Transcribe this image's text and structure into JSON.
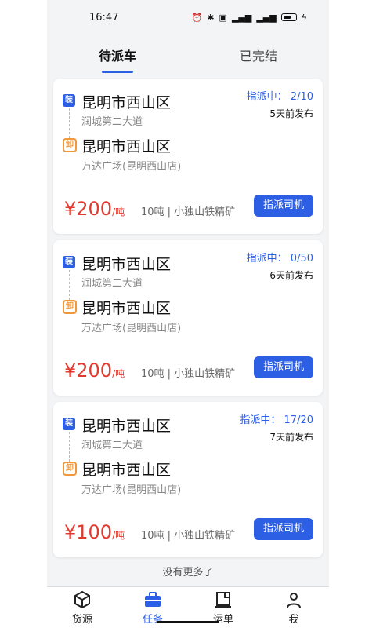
{
  "status_bar": {
    "time": "16:47",
    "icons": [
      "alarm-icon",
      "bluetooth-icon",
      "hd-icon",
      "signal-icon",
      "signal-icon",
      "battery-icon",
      "charging-icon"
    ]
  },
  "tabs": [
    {
      "label": "待派车",
      "active": true
    },
    {
      "label": "已完结",
      "active": false
    }
  ],
  "cards": [
    {
      "load_badge": "装",
      "unload_badge": "卸",
      "origin_city": "昆明市西山区",
      "origin_address": "润城第二大道",
      "dest_city": "昆明市西山区",
      "dest_address": "万达广场(昆明西山店)",
      "assign_status": "指派中：  2/10",
      "posted": "5天前发布",
      "price": "¥200",
      "price_unit": "/吨",
      "spec": "10吨 | 小独山铁精矿",
      "button": "指派司机"
    },
    {
      "load_badge": "装",
      "unload_badge": "卸",
      "origin_city": "昆明市西山区",
      "origin_address": "润城第二大道",
      "dest_city": "昆明市西山区",
      "dest_address": "万达广场(昆明西山店)",
      "assign_status": "指派中：  0/50",
      "posted": "6天前发布",
      "price": "¥200",
      "price_unit": "/吨",
      "spec": "10吨 | 小独山铁精矿",
      "button": "指派司机"
    },
    {
      "load_badge": "装",
      "unload_badge": "卸",
      "origin_city": "昆明市西山区",
      "origin_address": "润城第二大道",
      "dest_city": "昆明市西山区",
      "dest_address": "万达广场(昆明西山店)",
      "assign_status": "指派中：  17/20",
      "posted": "7天前发布",
      "price": "¥100",
      "price_unit": "/吨",
      "spec": "10吨 | 小独山铁精矿",
      "button": "指派司机"
    }
  ],
  "no_more": "没有更多了",
  "bottom_nav": [
    {
      "label": "货源",
      "icon": "box-icon",
      "active": false
    },
    {
      "label": "任务",
      "icon": "briefcase-icon",
      "active": true
    },
    {
      "label": "运单",
      "icon": "waybill-icon",
      "active": false
    },
    {
      "label": "我",
      "icon": "user-icon",
      "active": false
    }
  ],
  "colors": {
    "accent": "#2d5fe4",
    "price": "#e23a2e",
    "unload": "#f0983a"
  }
}
